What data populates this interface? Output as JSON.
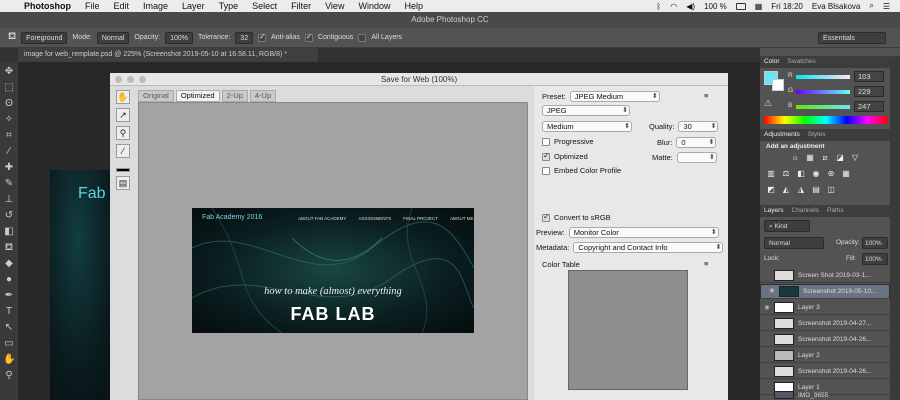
{
  "menubar": {
    "app": "Photoshop",
    "items": [
      "File",
      "Edit",
      "Image",
      "Layer",
      "Type",
      "Select",
      "Filter",
      "View",
      "Window",
      "Help"
    ],
    "battery": "100 %",
    "clock": "Fri 18:20",
    "user": "Eva Blsakova"
  },
  "ps": {
    "title": "Adobe Photoshop CC",
    "options": {
      "fill_source": "Foreground",
      "mode_label": "Mode:",
      "mode_value": "Normal",
      "opacity_label": "Opacity:",
      "opacity_value": "100%",
      "tolerance_label": "Tolerance:",
      "tolerance_value": "32",
      "antialias": "Anti-alias",
      "contiguous": "Contiguous",
      "all_layers": "All Layers",
      "workspace": "Essentials"
    },
    "doc_tab": "image for web_remplate.psd @ 225% (Screenshot 2019-05-10 at 16.58.11, RGB/8) *",
    "canvas_text": "Fab"
  },
  "dialog": {
    "title": "Save for Web (100%)",
    "tabs": [
      "Original",
      "Optimized",
      "2-Up",
      "4-Up"
    ],
    "active_tab": "Optimized",
    "banner": {
      "logo": "Fab Academy 2016",
      "nav": [
        "ABOUT FAB ACADEMY",
        "ASSIGNMENTS",
        "FINAL PROJECT",
        "ABOUT ME"
      ],
      "subtitle": "how to make (almost) everything",
      "title": "FAB LAB"
    },
    "settings": {
      "preset_label": "Preset:",
      "preset_value": "JPEG Medium",
      "format": "JPEG",
      "quality_level": "Medium",
      "quality_label": "Quality:",
      "quality_value": "30",
      "progressive": "Progressive",
      "blur_label": "Blur:",
      "blur_value": "0",
      "optimized": "Optimized",
      "matte_label": "Matte:",
      "embed_profile": "Embed Color Profile",
      "convert_srgb": "Convert to sRGB",
      "preview_label": "Preview:",
      "preview_value": "Monitor Color",
      "metadata_label": "Metadata:",
      "metadata_value": "Copyright and Contact Info",
      "color_table": "Color Table"
    }
  },
  "panels": {
    "color_tabs": [
      "Color",
      "Swatches"
    ],
    "color": {
      "r": "103",
      "g": "229",
      "b": "247"
    },
    "adj_tabs": [
      "Adjustments",
      "Styles"
    ],
    "add_adjustment": "Add an adjustment",
    "layer_tabs": [
      "Layers",
      "Channels",
      "Paths"
    ],
    "kind": "Kind",
    "blend_mode": "Normal",
    "opacity_label": "Opacity:",
    "opacity_value": "100%",
    "lock_label": "Lock:",
    "fill_label": "Fill:",
    "fill_value": "100%",
    "layers": [
      "Screen Shot 2019-03-1...",
      "Screenshot 2019-05-10...",
      "Layer 3",
      "Screenshot 2019-04-27...",
      "Screenshot 2019-04-26...",
      "Layer 2",
      "Screenshot 2019-04-26...",
      "Layer 1",
      "IMG_9655"
    ]
  }
}
